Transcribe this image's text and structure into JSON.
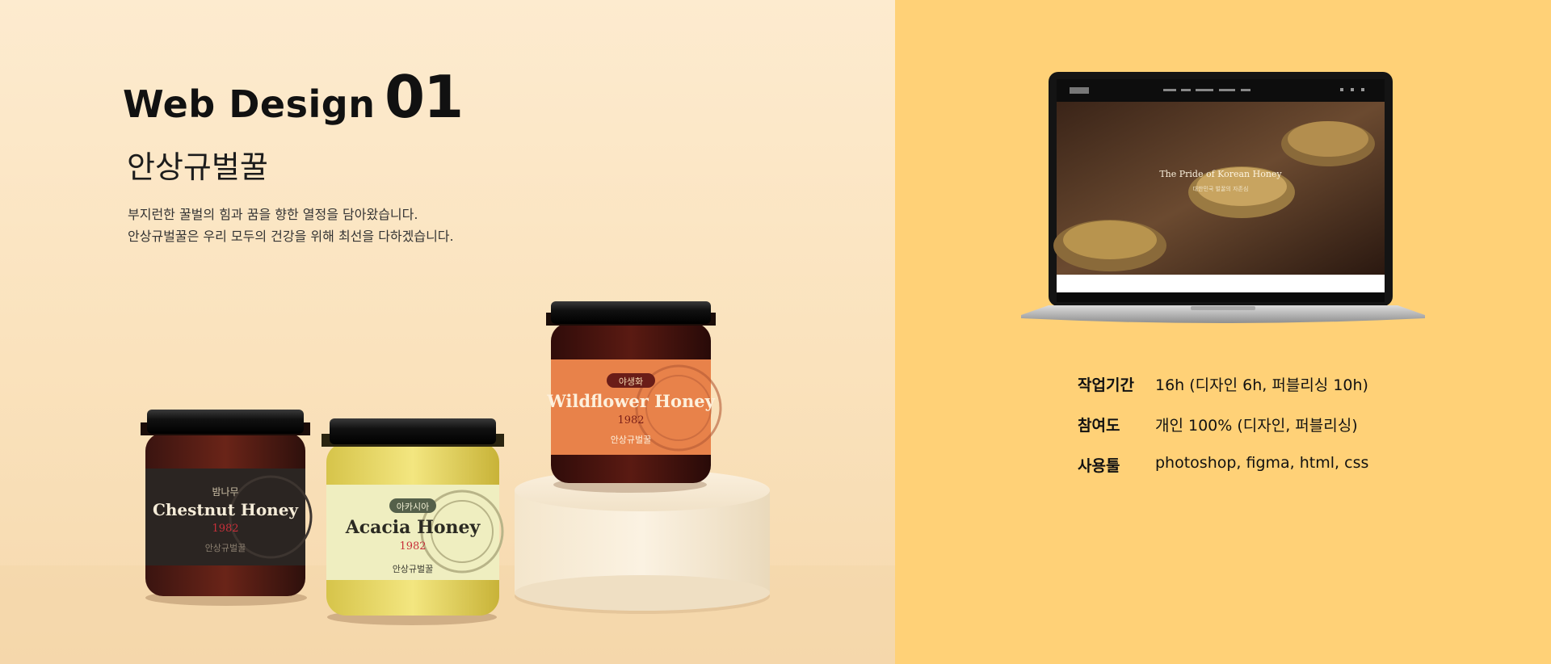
{
  "header": {
    "title_word": "Web Design",
    "title_number": "01"
  },
  "brand_name": "안상규벌꿀",
  "description": [
    "부지런한 꿀벌의 힘과 꿈을 향한 열정을 담아왔습니다.",
    "안상규벌꿀은 우리 모두의 건강을 위해 최선을 다하겠습니다."
  ],
  "jars": [
    {
      "korean": "밤나무",
      "name": "Chestnut Honey",
      "year": "1982",
      "brand": "안상규벌꿀",
      "color": "#2b2522"
    },
    {
      "korean": "아카시아",
      "name": "Acacia Honey",
      "year": "1982",
      "brand": "안상규벌꿀",
      "color": "#efeec0"
    },
    {
      "korean": "야생화",
      "name": "Wildflower Honey",
      "year": "1982",
      "brand": "안상규벌꿀",
      "color": "#e8824a"
    }
  ],
  "laptop_screen": {
    "hero_title": "The Pride of Korean Honey",
    "hero_subtitle": "대한민국 벌꿀의 자존심"
  },
  "info": {
    "rows": [
      {
        "label": "작업기간",
        "value": "16h (디자인 6h, 퍼블리싱 10h)"
      },
      {
        "label": "참여도",
        "value": "개인 100% (디자인, 퍼블리싱)"
      },
      {
        "label": "사용툴",
        "value": "photoshop, figma, html, css"
      }
    ]
  },
  "colors": {
    "left_bg": "#fae2bc",
    "right_bg": "#ffd177",
    "chestnut_label": "#2b2522",
    "acacia_label": "#efeec0",
    "wildflower_label": "#e8824a"
  }
}
